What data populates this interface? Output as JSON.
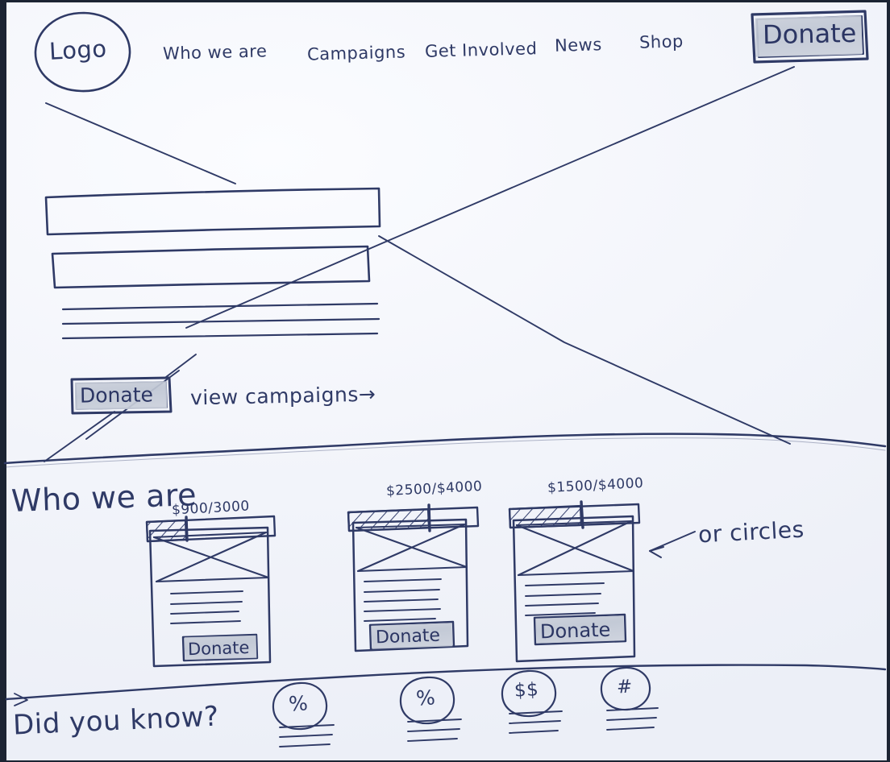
{
  "meta": {
    "title": "Hand-drawn website wireframe sketch",
    "ink_color": "#2f3a66",
    "paper_color": "#f2f4fa",
    "shade_color": "#c6ccd8",
    "border_color": "#1c2433"
  },
  "header": {
    "logo_label": "Logo",
    "nav_items": [
      {
        "label": "Who we are"
      },
      {
        "label": "Campaigns"
      },
      {
        "label": "Get Involved"
      },
      {
        "label": "News"
      },
      {
        "label": "Shop"
      }
    ],
    "donate_button_label": "Donate"
  },
  "hero": {
    "headline_placeholder": "",
    "subheadline_placeholder": "",
    "body_line_count": 3,
    "donate_button_label": "Donate",
    "secondary_link_label": "view campaigns→"
  },
  "campaigns_section": {
    "heading": "Who we are",
    "annotation": "or circles",
    "cards": [
      {
        "progress_label": "$900/3000",
        "raised": 900,
        "goal": 3000,
        "progress_percent": 30,
        "text_line_count": 4,
        "donate_button_label": "Donate"
      },
      {
        "progress_label": "$2500/$4000",
        "raised": 2500,
        "goal": 4000,
        "progress_percent": 62,
        "text_line_count": 5,
        "donate_button_label": "Donate"
      },
      {
        "progress_label": "$1500/$4000",
        "raised": 1500,
        "goal": 4000,
        "progress_percent": 55,
        "text_line_count": 4,
        "donate_button_label": "Donate"
      }
    ]
  },
  "facts_section": {
    "heading": "Did you know?",
    "stats": [
      {
        "icon_glyph": "%",
        "icon_name": "percent-icon",
        "text_line_count": 3
      },
      {
        "icon_glyph": "%",
        "icon_name": "percent-icon",
        "text_line_count": 3
      },
      {
        "icon_glyph": "$$",
        "icon_name": "dollar-dollar-icon",
        "text_line_count": 3
      },
      {
        "icon_glyph": "#",
        "icon_name": "hash-number-icon",
        "text_line_count": 3
      }
    ]
  }
}
